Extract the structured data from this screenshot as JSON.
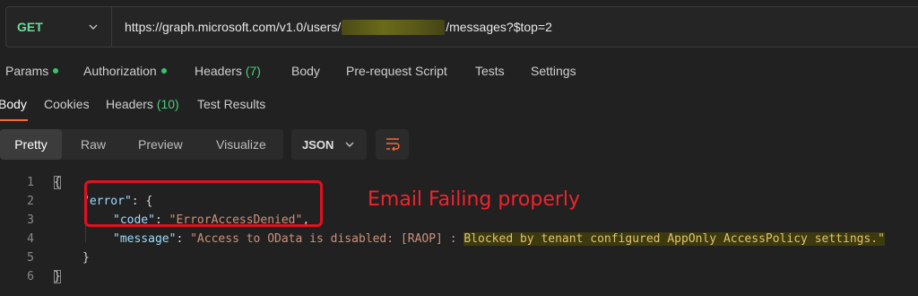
{
  "request": {
    "method": "GET",
    "url_prefix": "https://graph.microsoft.com/v1.0/users/",
    "url_suffix": "/messages?$top=2"
  },
  "request_tabs": [
    {
      "label": "Params",
      "dot": true
    },
    {
      "label": "Authorization",
      "dot": true
    },
    {
      "label": "Headers",
      "count": "(7)"
    },
    {
      "label": "Body"
    },
    {
      "label": "Pre-request Script"
    },
    {
      "label": "Tests"
    },
    {
      "label": "Settings"
    }
  ],
  "response_tabs": [
    {
      "label": "Body",
      "active": true
    },
    {
      "label": "Cookies"
    },
    {
      "label": "Headers",
      "count": "(10)"
    },
    {
      "label": "Test Results"
    }
  ],
  "view_modes": [
    "Pretty",
    "Raw",
    "Preview",
    "Visualize"
  ],
  "selected_view_mode": "Pretty",
  "format": "JSON",
  "code": {
    "line_numbers": [
      "1",
      "2",
      "3",
      "4",
      "5",
      "6"
    ],
    "line1": "{",
    "line2_key": "\"error\"",
    "line2_rest": ": {",
    "line3_key": "\"code\"",
    "line3_sep": ": ",
    "line3_val": "\"ErrorAccessDenied\"",
    "line3_end": ",",
    "line4_key": "\"message\"",
    "line4_sep": ": ",
    "line4_val_a": "\"Access to OData is disabled: [RAOP] : ",
    "line4_val_b": "Blocked by tenant configured AppOnly AccessPolicy settings.\"",
    "line5": "}",
    "line6": "}"
  },
  "annotation": "Email Failing properly",
  "colors": {
    "method": "#6bdd9a",
    "status_dot": "#35c46c",
    "accent_underline": "#f26b3a",
    "annotation_red": "#e3101f"
  },
  "icons": {
    "method_dropdown": "chevron-down-icon",
    "format_dropdown": "chevron-down-icon",
    "wrap": "wrap-lines-icon"
  }
}
